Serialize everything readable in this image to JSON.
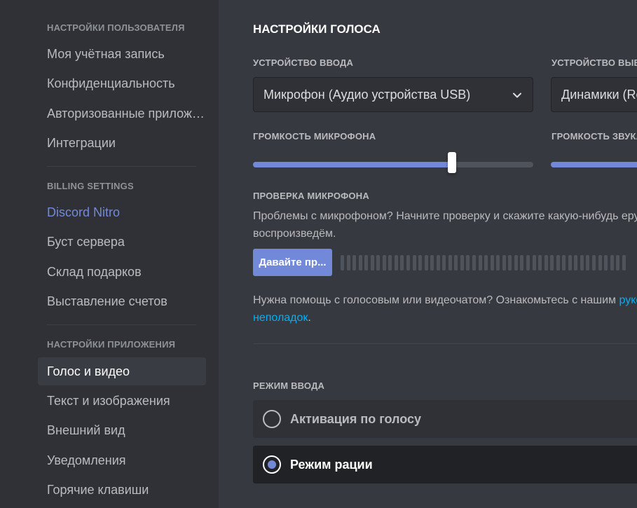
{
  "sidebar": {
    "user_settings": {
      "header": "НАСТРОЙКИ ПОЛЬЗОВАТЕЛЯ",
      "items": [
        {
          "label": "Моя учётная запись"
        },
        {
          "label": "Конфиденциальность"
        },
        {
          "label": "Авторизованные приложения"
        },
        {
          "label": "Интеграции"
        }
      ]
    },
    "billing_settings": {
      "header": "BILLING SETTINGS",
      "items": [
        {
          "label": "Discord Nitro"
        },
        {
          "label": "Буст сервера"
        },
        {
          "label": "Склад подарков"
        },
        {
          "label": "Выставление счетов"
        }
      ]
    },
    "app_settings": {
      "header": "НАСТРОЙКИ ПРИЛОЖЕНИЯ",
      "items": [
        {
          "label": "Голос и видео",
          "selected": true
        },
        {
          "label": "Текст и изображения"
        },
        {
          "label": "Внешний вид"
        },
        {
          "label": "Уведомления"
        },
        {
          "label": "Горячие клавиши"
        }
      ]
    }
  },
  "main": {
    "title": "НАСТРОЙКИ ГОЛОСА",
    "input_device": {
      "label": "УСТРОЙСТВО ВВОДА",
      "value": "Микрофон (Аудио устройства USB)"
    },
    "output_device": {
      "label": "УСТРОЙСТВО ВЫВОДА",
      "value": "Динамики (Realtek)"
    },
    "mic_volume": {
      "label": "ГРОМКОСТЬ МИКРОФОНА",
      "value_percent": 71
    },
    "output_volume": {
      "label": "ГРОМКОСТЬ ЗВУКА",
      "value_percent": 100
    },
    "mic_test": {
      "label": "ПРОВЕРКА МИКРОФОНА",
      "description_line1": "Проблемы с микрофоном? Начните проверку и скажите какую-нибудь ерунду — мы её",
      "description_line2": "воспроизведём.",
      "button_label": "Давайте пр...",
      "meter_bars": 48
    },
    "help": {
      "text_before_link": "Нужна помощь с голосовым или видеочатом? Ознакомьтесь с нашим ",
      "link_line1": "руководством по устранению",
      "link_line2": "неполадок",
      "text_after_link": "."
    },
    "input_mode": {
      "label": "РЕЖИМ ВВОДА",
      "options": [
        {
          "label": "Активация по голосу",
          "selected": false
        },
        {
          "label": "Режим рации",
          "selected": true
        }
      ]
    }
  },
  "colors": {
    "accent": "#7289da",
    "link": "#00b0f4",
    "sidebar_bg": "#2f3136",
    "content_bg": "#36393f"
  }
}
